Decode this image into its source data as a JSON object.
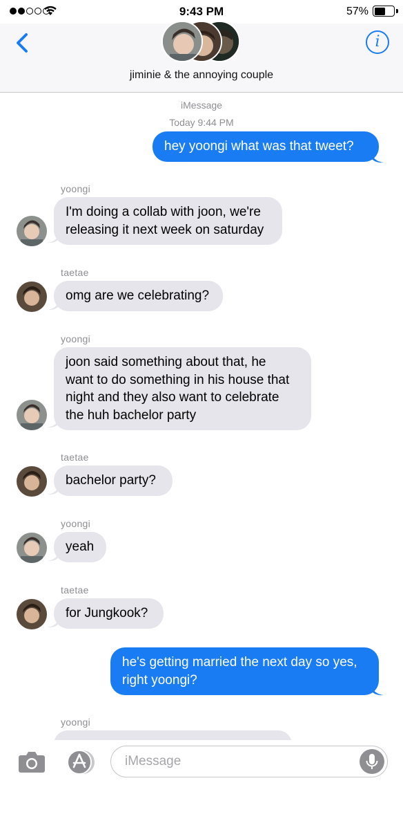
{
  "status_bar": {
    "time": "9:43 PM",
    "battery_percent_label": "57%",
    "battery_level": 0.57,
    "signal_bars_filled": 2,
    "signal_bars_total": 5
  },
  "header": {
    "group_name": "jiminie & the annoying couple",
    "back_icon": "chevron-left-icon",
    "info_icon": "info-icon",
    "info_glyph": "i",
    "accent_color": "#1a7cf2"
  },
  "meta": {
    "service": "iMessage",
    "timestamp": "Today 9:44 PM"
  },
  "messages": [
    {
      "direction": "outgoing",
      "text": "hey yoongi what was that tweet?"
    },
    {
      "direction": "incoming",
      "sender": "yoongi",
      "text_lines": [
        "I'm doing a collab with joon, we're",
        "releasing it next week on saturday"
      ]
    },
    {
      "direction": "incoming",
      "sender": "taetae",
      "text": "omg are we celebrating?"
    },
    {
      "direction": "incoming",
      "sender": "yoongi",
      "text_lines": [
        "joon said something about that, he",
        "want to do something in his house that",
        "night and they also want to celebrate",
        "the huh bachelor party"
      ]
    },
    {
      "direction": "incoming",
      "sender": "taetae",
      "text": "bachelor party?"
    },
    {
      "direction": "incoming",
      "sender": "yoongi",
      "text": "yeah"
    },
    {
      "direction": "incoming",
      "sender": "taetae",
      "text": "for Jungkook?"
    },
    {
      "direction": "outgoing",
      "text_lines": [
        "he's getting married the next day so yes,",
        "right yoongi?"
      ]
    },
    {
      "direction": "incoming",
      "sender": "yoongi",
      "text": ""
    }
  ],
  "input_bar": {
    "placeholder": "iMessage",
    "camera_icon": "camera-icon",
    "appstore_icon": "app-store-icon",
    "mic_icon": "microphone-icon"
  },
  "colors": {
    "outgoing_bubble": "#1a7cf2",
    "incoming_bubble": "#e6e5eb",
    "meta_text": "#8e8e93"
  }
}
